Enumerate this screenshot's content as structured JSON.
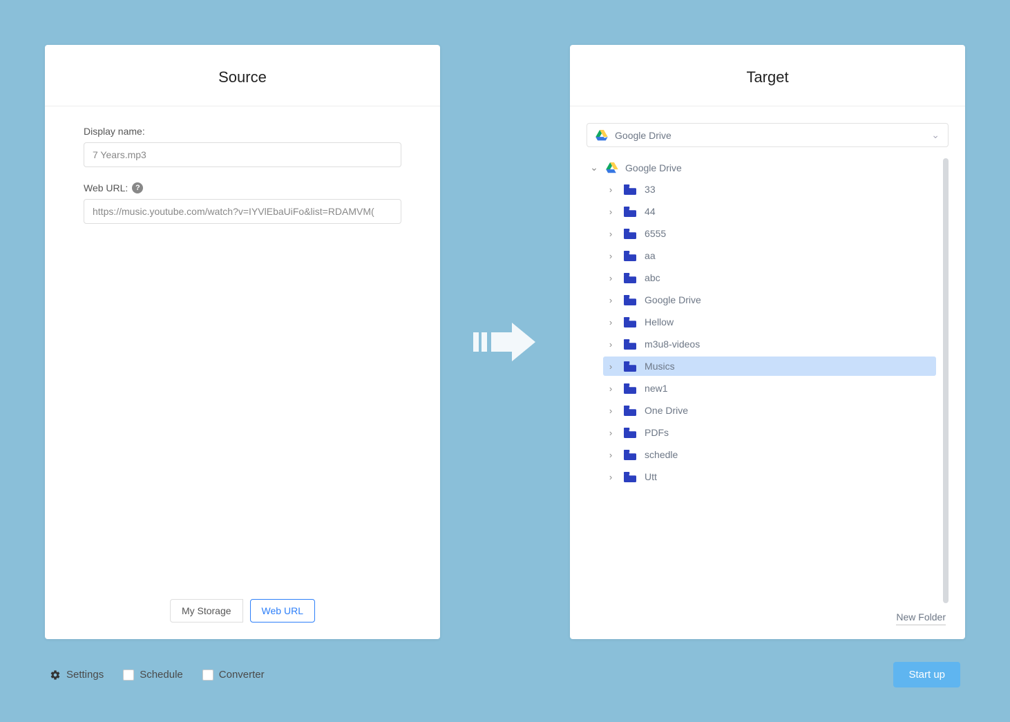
{
  "source": {
    "title": "Source",
    "display_name_label": "Display name:",
    "display_name_value": "7 Years.mp3",
    "web_url_label": "Web URL:",
    "web_url_value": "https://music.youtube.com/watch?v=IYVlEbaUiFo&list=RDAMVM(",
    "tabs": {
      "my_storage": "My Storage",
      "web_url": "Web URL"
    }
  },
  "target": {
    "title": "Target",
    "selected_drive": "Google Drive",
    "root_label": "Google Drive",
    "folders": [
      {
        "name": "33",
        "selected": false
      },
      {
        "name": "44",
        "selected": false
      },
      {
        "name": "6555",
        "selected": false
      },
      {
        "name": "aa",
        "selected": false
      },
      {
        "name": "abc",
        "selected": false
      },
      {
        "name": "Google Drive",
        "selected": false
      },
      {
        "name": "Hellow",
        "selected": false
      },
      {
        "name": "m3u8-videos",
        "selected": false
      },
      {
        "name": "Musics",
        "selected": true
      },
      {
        "name": "new1",
        "selected": false
      },
      {
        "name": "One Drive",
        "selected": false
      },
      {
        "name": "PDFs",
        "selected": false
      },
      {
        "name": "schedle",
        "selected": false
      },
      {
        "name": "Utt",
        "selected": false
      }
    ],
    "new_folder_label": "New Folder"
  },
  "bottom": {
    "settings": "Settings",
    "schedule": "Schedule",
    "converter": "Converter",
    "start": "Start up"
  }
}
